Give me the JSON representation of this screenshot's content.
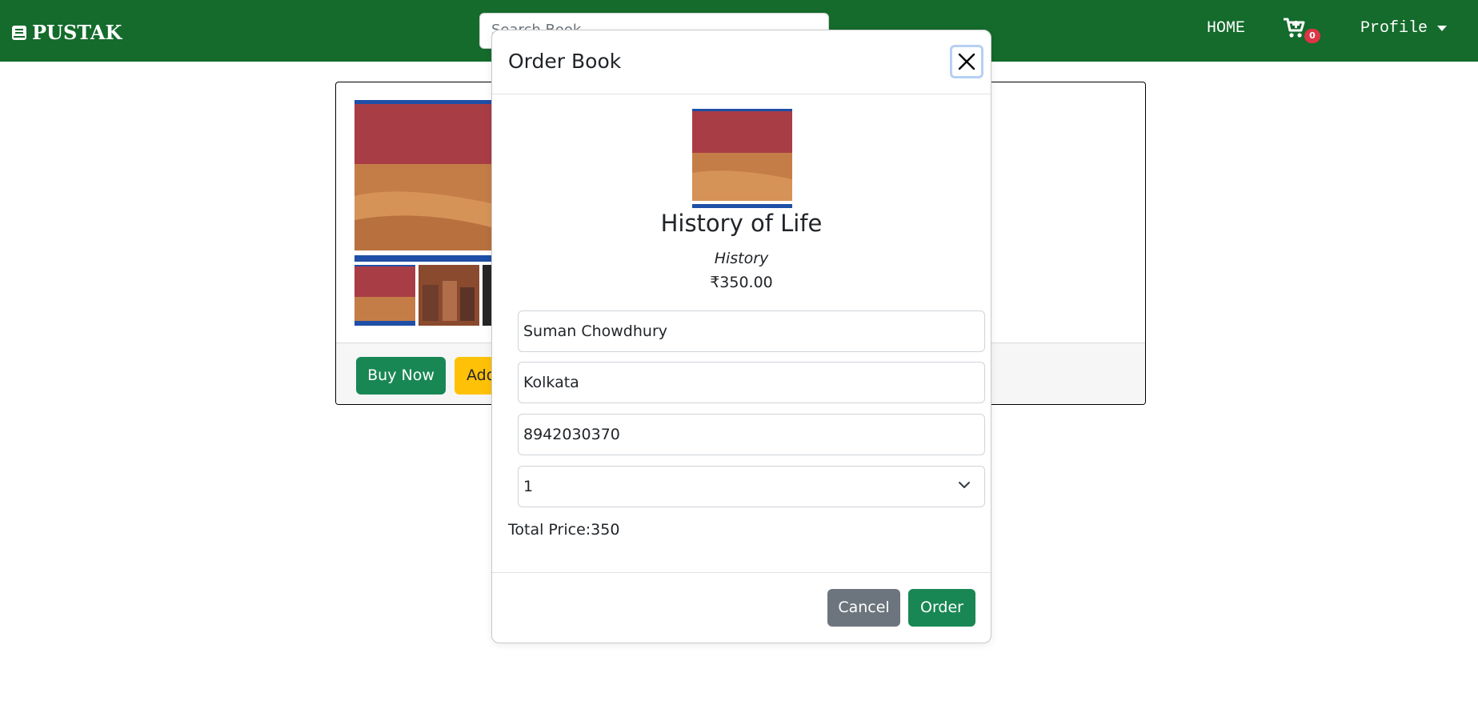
{
  "navbar": {
    "brand": "PUSTAK",
    "search_placeholder": "Search Book",
    "home_label": "HOME",
    "cart_count": "0",
    "profile_label": "Profile"
  },
  "card": {
    "buy_label": "Buy Now",
    "add_label": "Add"
  },
  "modal": {
    "title": "Order Book",
    "book_title": "History of Life",
    "book_category": "History",
    "book_price": "₹350.00",
    "name_value": "Suman Chowdhury",
    "city_value": "Kolkata",
    "phone_value": "8942030370",
    "quantity_value": "1",
    "total_label": "Total Price:350",
    "cancel_label": "Cancel",
    "order_label": "Order"
  },
  "colors": {
    "navbar": "#146b2c",
    "success": "#198754",
    "warning": "#ffc107",
    "secondary": "#6c757d",
    "badge": "#dc3545"
  }
}
